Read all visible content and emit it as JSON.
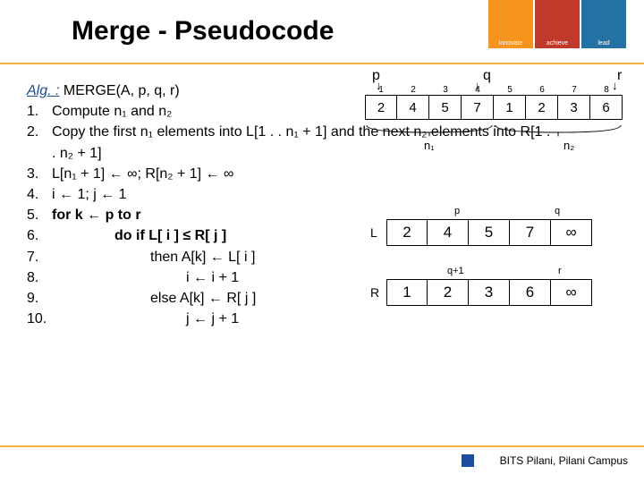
{
  "title": "Merge - Pseudocode",
  "logo": {
    "w1": "innovate",
    "w2": "achieve",
    "w3": "lead"
  },
  "alg_label": "Alg. :",
  "alg_sig": " MERGE(A, p, q, r)",
  "lines": {
    "l1n": "1.",
    "l1": "Compute n₁ and n₂",
    "l2n": "2.",
    "l2": "Copy the first n₁ elements into  L[1 . . n₁ + 1] and the next n₂ elements into R[1 . . n₂ + 1]",
    "l3n": "3.",
    "l3": "L[n₁ + 1] ← ∞;     R[n₂ + 1] ← ∞",
    "l4n": "4.",
    "l4": "i ← 1;     j ← 1",
    "l5n": "5.",
    "l5": "for k ← p to r",
    "l6n": "6.",
    "l6": "do if L[ i ] ≤ R[ j ]",
    "l7n": "7.",
    "l7": "then A[k] ← L[ i ]",
    "l8n": "8.",
    "l8": "i ← i + 1",
    "l9n": "9.",
    "l9": "else A[k] ← R[ j ]",
    "l10n": "10.",
    "l10": "j ← j + 1"
  },
  "pqr": {
    "p": "p",
    "q": "q",
    "r": "r"
  },
  "main_idx": [
    "1",
    "2",
    "3",
    "4",
    "5",
    "6",
    "7",
    "8"
  ],
  "main_vals": [
    "2",
    "4",
    "5",
    "7",
    "1",
    "2",
    "3",
    "6"
  ],
  "n1": "n₁",
  "n2": "n₂",
  "L_label": "L",
  "R_label": "R",
  "L_vals": [
    "2",
    "4",
    "5",
    "7",
    "∞"
  ],
  "R_vals": [
    "1",
    "2",
    "3",
    "6",
    "∞"
  ],
  "sm_p": "p",
  "sm_q": "q",
  "sm_q1": "q+1",
  "sm_r": "r",
  "footer": "BITS Pilani, Pilani Campus"
}
